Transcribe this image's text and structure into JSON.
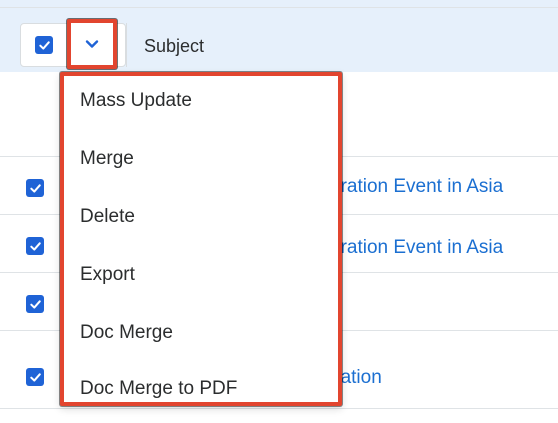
{
  "header": {
    "select_all_checked": true,
    "column_label": "Subject"
  },
  "rows": [
    {
      "checked": true,
      "link_text": "eration Event in Asia"
    },
    {
      "checked": true,
      "link_text": "eration Event in Asia"
    },
    {
      "checked": true,
      "link_text": ""
    },
    {
      "checked": true,
      "link_text": "nation"
    }
  ],
  "actions_menu": {
    "items": [
      {
        "label": "Mass Update"
      },
      {
        "label": "Merge"
      },
      {
        "label": "Delete"
      },
      {
        "label": "Export"
      },
      {
        "label": "Doc Merge"
      },
      {
        "label": "Doc Merge to PDF"
      }
    ]
  },
  "colors": {
    "checkbox": "#1f63d6",
    "highlight_border": "#e2452f",
    "link": "#1b6fd1",
    "selected_band": "#e6f0fb"
  },
  "icons": {
    "checkbox_mark": "checkmark-icon",
    "actions_toggle": "chevron-down-icon"
  }
}
